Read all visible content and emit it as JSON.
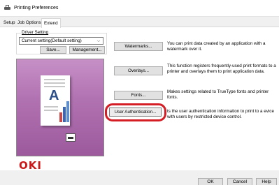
{
  "window": {
    "title": "Printing Preferences"
  },
  "tabs": [
    {
      "label": "Setup"
    },
    {
      "label": "Job Options"
    },
    {
      "label": "Extend"
    }
  ],
  "driver_setting": {
    "group_label": "Driver Setting",
    "selected": "Current setting(Default setting)",
    "save_label": "Save...",
    "management_label": "Management..."
  },
  "features": [
    {
      "button": "Watermarks...",
      "description": "You can print data created by an application with a watermark over it."
    },
    {
      "button": "Overlays...",
      "description": "This function registers frequently-used print formats to a printer and overlays them to print application data."
    },
    {
      "button": "Fonts...",
      "description": "Makes settings related to TrueType fonts and printer fonts."
    },
    {
      "button": "User Authentication...",
      "description": "ts the user authentication information to print to a evice with users by restricted device control."
    }
  ],
  "brand": {
    "logo_text": "OKI",
    "color": "#cc1818"
  },
  "highlight_color": "#d51d25",
  "footer": {
    "ok_label": "OK",
    "cancel_label": "Cancel",
    "help_label": "Help"
  },
  "preview": {
    "letter": "A"
  }
}
